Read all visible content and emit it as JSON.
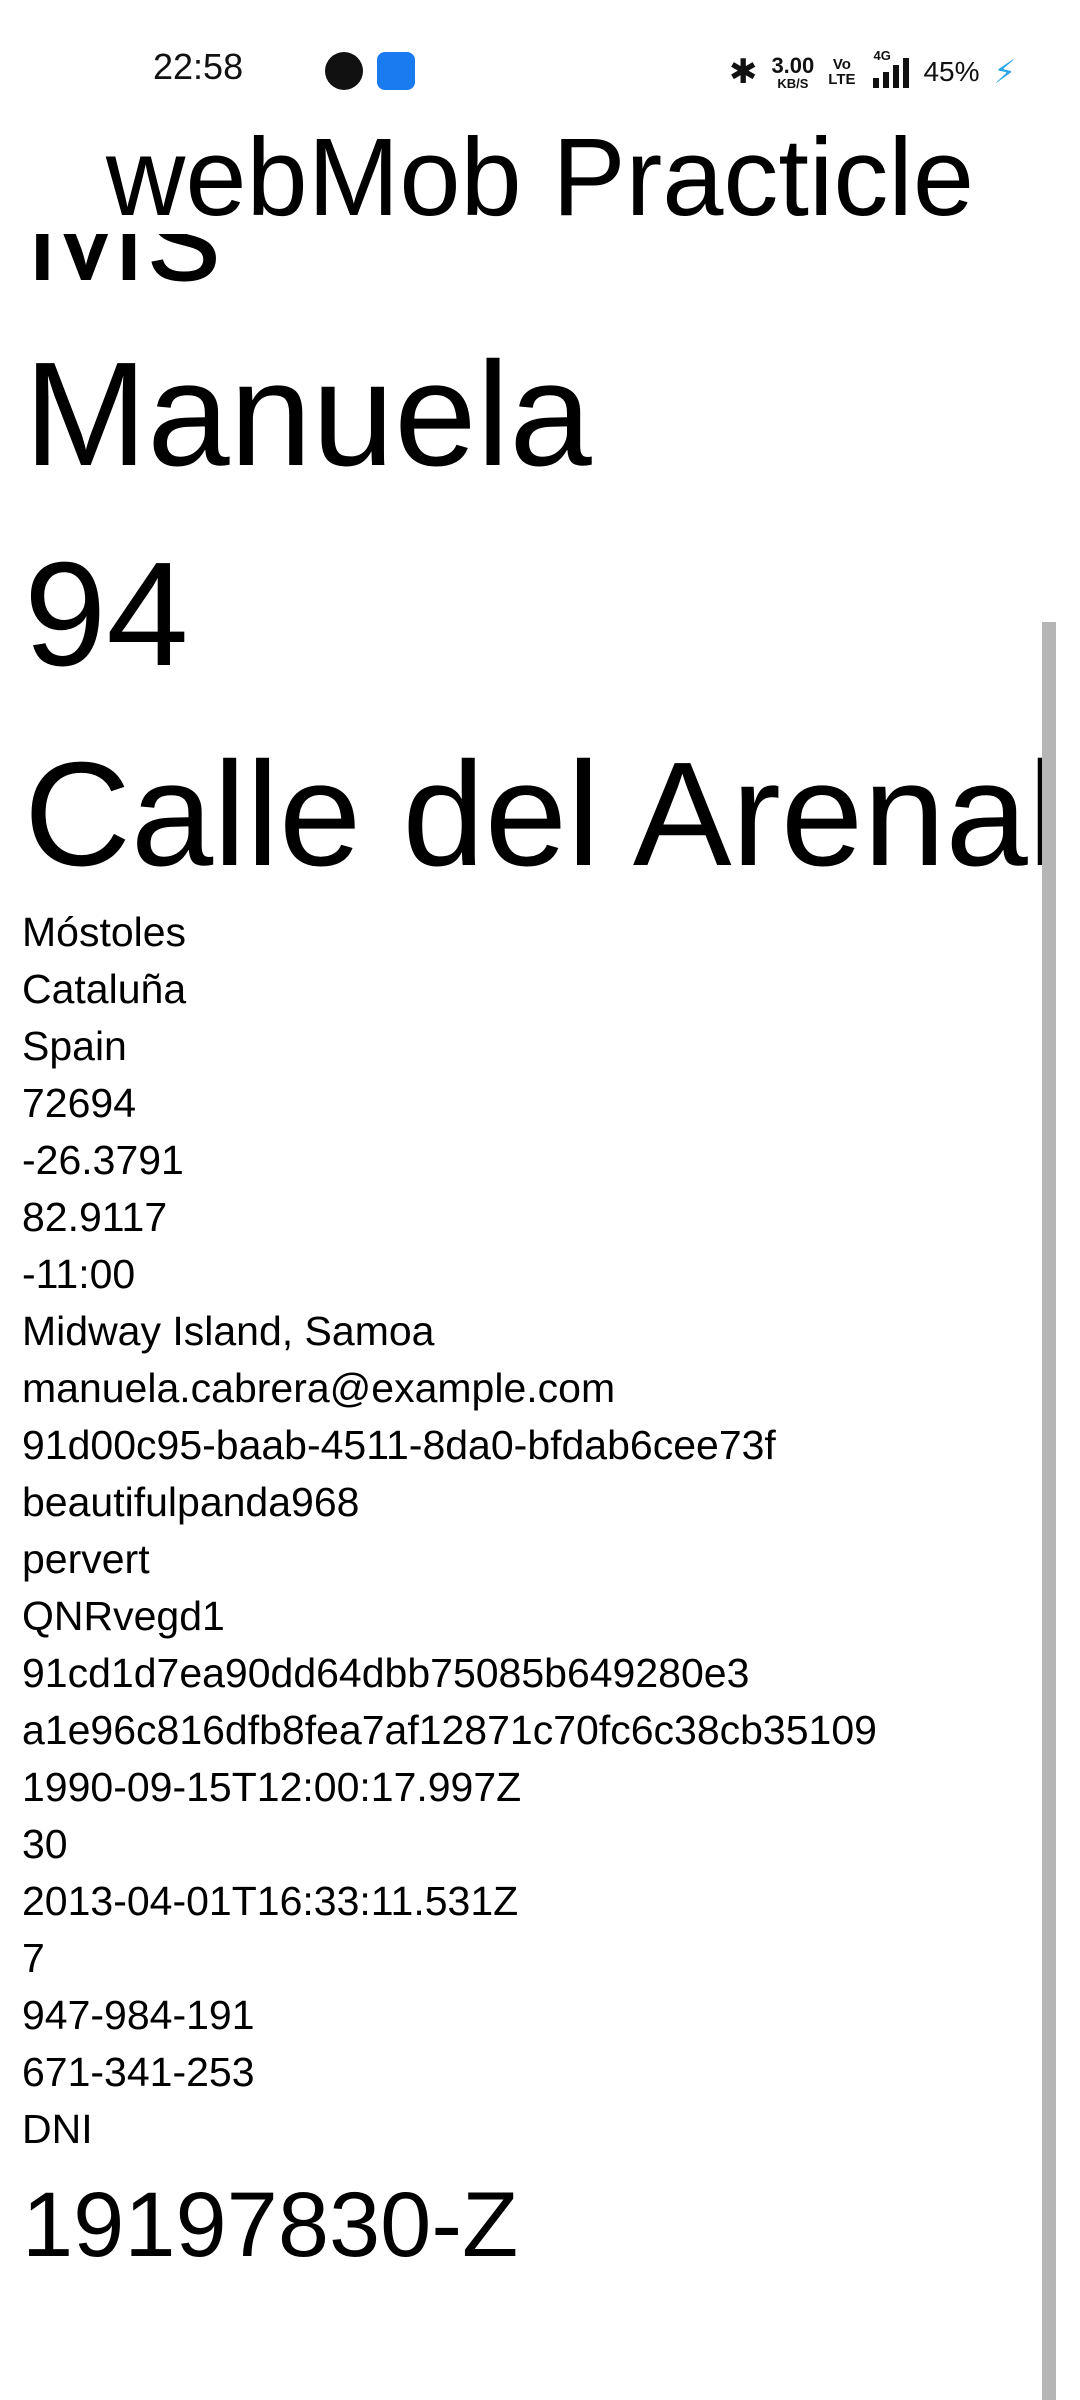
{
  "status_bar": {
    "time": "22:58",
    "bluetooth": "✱",
    "speed_value": "3.00",
    "speed_unit": "KB/S",
    "volte_top": "Vo",
    "volte_bottom": "LTE",
    "network": "4G",
    "battery": "45%",
    "charging": "⚡"
  },
  "app": {
    "title": "webMob Practicle"
  },
  "content": {
    "title_fragment": "Ms",
    "first_name": "Manuela",
    "street_number": "94",
    "street_name": "Calle del Arenal",
    "details": [
      "Móstoles",
      "Cataluña",
      "Spain",
      "72694",
      "-26.3791",
      "82.9117",
      "-11:00",
      "Midway Island, Samoa",
      "manuela.cabrera@example.com",
      "91d00c95-baab-4511-8da0-bfdab6cee73f",
      "beautifulpanda968",
      "pervert",
      "QNRvegd1",
      "91cd1d7ea90dd64dbb75085b649280e3",
      "a1e96c816dfb8fea7af12871c70fc6c38cb35109",
      "1990-09-15T12:00:17.997Z",
      "30",
      "2013-04-01T16:33:11.531Z",
      "7",
      "947-984-191",
      "671-341-253",
      "DNI"
    ],
    "id_value": "19197830-Z"
  }
}
